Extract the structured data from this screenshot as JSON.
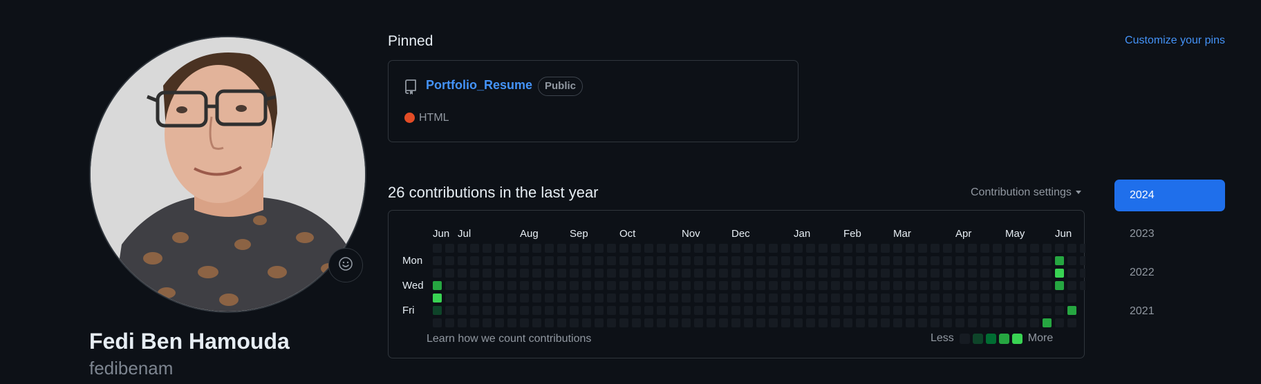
{
  "profile": {
    "full_name": "Fedi Ben Hamouda",
    "username": "fedibenam"
  },
  "pinned": {
    "title": "Pinned",
    "customize_label": "Customize your pins",
    "repos": [
      {
        "name": "Portfolio_Resume",
        "visibility": "Public",
        "language": "HTML",
        "language_color": "#e34c26"
      }
    ]
  },
  "contributions": {
    "title": "26 contributions in the last year",
    "settings_label": "Contribution settings",
    "months": [
      "Jun",
      "Jul",
      "Aug",
      "Sep",
      "Oct",
      "Nov",
      "Dec",
      "Jan",
      "Feb",
      "Mar",
      "Apr",
      "May",
      "Jun"
    ],
    "day_labels": [
      "Mon",
      "Wed",
      "Fri"
    ],
    "learn_link": "Learn how we count contributions",
    "legend_less": "Less",
    "legend_more": "More",
    "level_colors": [
      "#161b22",
      "#0e4429",
      "#006d32",
      "#26a641",
      "#39d353"
    ],
    "active_cells": [
      {
        "week": 0,
        "day": 3,
        "level": 3
      },
      {
        "week": 0,
        "day": 4,
        "level": 4
      },
      {
        "week": 0,
        "day": 5,
        "level": 1
      },
      {
        "week": 49,
        "day": 6,
        "level": 3
      },
      {
        "week": 50,
        "day": 1,
        "level": 3
      },
      {
        "week": 50,
        "day": 2,
        "level": 4
      },
      {
        "week": 50,
        "day": 3,
        "level": 3
      },
      {
        "week": 51,
        "day": 5,
        "level": 3
      }
    ]
  },
  "years": {
    "items": [
      "2024",
      "2023",
      "2022",
      "2021"
    ],
    "selected": "2024"
  }
}
